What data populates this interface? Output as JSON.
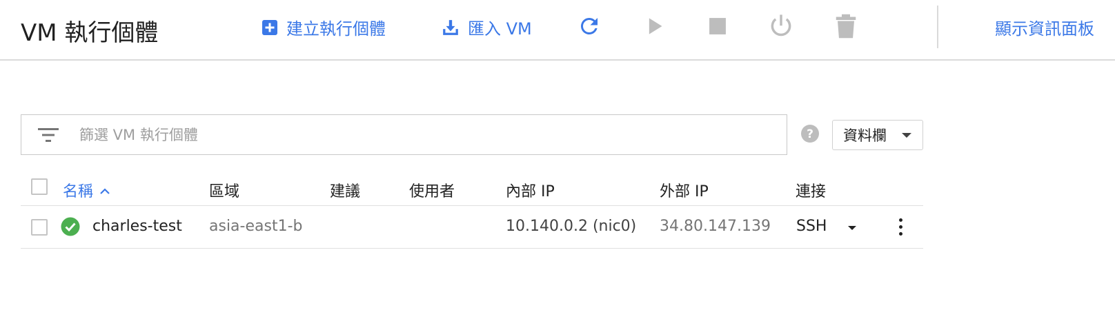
{
  "header": {
    "title": "VM 執行個體",
    "create_label": "建立執行個體",
    "import_label": "匯入 VM",
    "dashboard_label": "顯示資訊面板"
  },
  "icons": {
    "create": "add-box-icon",
    "import": "download-icon",
    "refresh": "refresh-icon",
    "start": "play-icon",
    "stop": "stop-icon",
    "reset": "power-icon",
    "delete": "trash-icon",
    "filter": "filter-list-icon",
    "help": "help-circle-icon",
    "status": "check-circle-icon",
    "more": "more-vert-icon"
  },
  "colors": {
    "accent": "#3b78e7",
    "status_ok": "#4caf50",
    "disabled_icon": "#bdbdbd"
  },
  "filter": {
    "placeholder": "篩選 VM 執行個體",
    "value": ""
  },
  "columns_button": {
    "label": "資料欄"
  },
  "table": {
    "headers": {
      "name": "名稱",
      "zone": "區域",
      "recommendation": "建議",
      "user": "使用者",
      "internal_ip": "內部 IP",
      "external_ip": "外部 IP",
      "connect": "連接"
    },
    "rows": [
      {
        "status": "running",
        "name": "charles-test",
        "zone": "asia-east1-b",
        "recommendation": "",
        "user": "",
        "internal_ip": "10.140.0.2 (nic0)",
        "external_ip": "34.80.147.139",
        "connect": "SSH"
      }
    ]
  }
}
